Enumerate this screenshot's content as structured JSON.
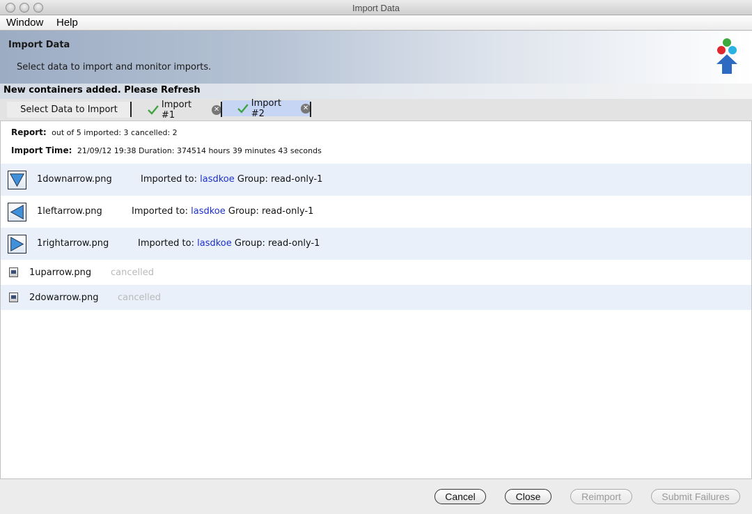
{
  "window": {
    "title": "Import Data"
  },
  "menu": {
    "items": [
      "Window",
      "Help"
    ]
  },
  "header": {
    "title": "Import Data",
    "subtitle": "Select data to import and monitor imports.",
    "logo_icon": "import-logo-icon"
  },
  "notice": "New containers added. Please Refresh",
  "tabs": [
    {
      "label": "Select Data to Import"
    },
    {
      "label": "Import #1"
    },
    {
      "label": "Import #2"
    }
  ],
  "report": {
    "report_label": "Report:",
    "report_value": "out of 5 imported: 3 cancelled: 2",
    "time_label": "Import Time:",
    "time_value": "21/09/12 19:38 Duration: 374514 hours 39 minutes 43 seconds"
  },
  "files": [
    {
      "name": "1downarrow.png",
      "imported_label": "Imported to:",
      "target": "lasdkoe",
      "group": "Group: read-only-1"
    },
    {
      "name": "1leftarrow.png",
      "imported_label": "Imported to:",
      "target": "lasdkoe",
      "group": "Group: read-only-1"
    },
    {
      "name": "1rightarrow.png",
      "imported_label": "Imported to:",
      "target": "lasdkoe",
      "group": "Group: read-only-1"
    },
    {
      "name": "1uparrow.png",
      "status": "cancelled"
    },
    {
      "name": "2dowarrow.png",
      "status": "cancelled"
    }
  ],
  "buttons": {
    "cancel": "Cancel",
    "close": "Close",
    "reimport": "Reimport",
    "submit_failures": "Submit Failures"
  }
}
